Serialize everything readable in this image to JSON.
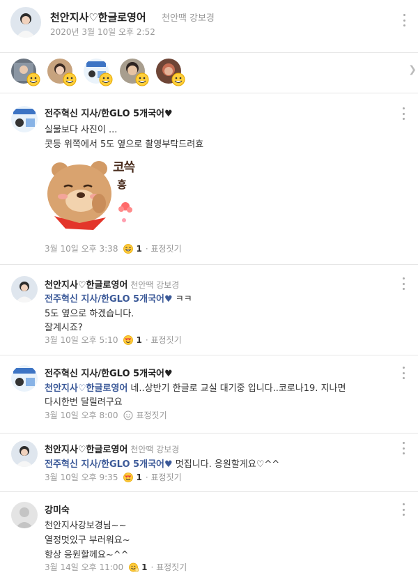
{
  "post": {
    "author": "천안지사♡한글로영어",
    "author_sub": "천안땍 강보경",
    "date": "2020년 3월 10일 오후 2:52"
  },
  "reaction_icon": "smile-hand-emoji",
  "comments": [
    {
      "author": "전주혁신 지사/한GLO 5개국어♥",
      "sub": "",
      "lines": [
        "실물보다 사진이 ...",
        "콧등 위쪽에서 5도 옆으로 촬영부탁드려효"
      ],
      "sticker_text": "코쓱",
      "sticker_text2": "흥",
      "time": "3월 10일 오후 3:38",
      "reaction": "smile",
      "count": "1",
      "action": "표정짓기"
    },
    {
      "author": "천안지사♡한글로영어",
      "sub": "천안땍 강보경",
      "mention": "전주혁신 지사/한GLO 5개국어♥",
      "mention_tail": " ㅋㅋ",
      "lines": [
        "5도 옆으로  하겠습니다.",
        "잘계시죠?"
      ],
      "time": "3월 10일 오후 5:10",
      "reaction": "love",
      "count": "1",
      "action": "표정짓기"
    },
    {
      "author": "전주혁신 지사/한GLO 5개국어♥",
      "sub": "",
      "mention": "천안지사♡한글로영어",
      "mention_tail": " 네..상반기 한글로 교실 대기중 입니다..코로나19. 지나면",
      "lines": [
        "다시한번 달릴려구요"
      ],
      "time": "3월 10일 오후 8:00",
      "action": "표정짓기"
    },
    {
      "author": "천안지사♡한글로영어",
      "sub": "천안땍 강보경",
      "mention": "전주혁신 지사/한GLO 5개국어♥",
      "mention_tail": " 멋집니다.  응원할게요♡^^",
      "lines": [],
      "time": "3월 10일 오후 9:35",
      "reaction": "love",
      "count": "1",
      "action": "표정짓기"
    },
    {
      "author": "강미숙",
      "sub": "",
      "lines": [
        "천안지사강보경님~~",
        "열정멋있구 부러워요~",
        "항상 응원할께요~^^"
      ],
      "time": "3월 14일 오후 11:00",
      "reaction": "smile-hand",
      "count": "1",
      "action": "표정짓기"
    }
  ]
}
